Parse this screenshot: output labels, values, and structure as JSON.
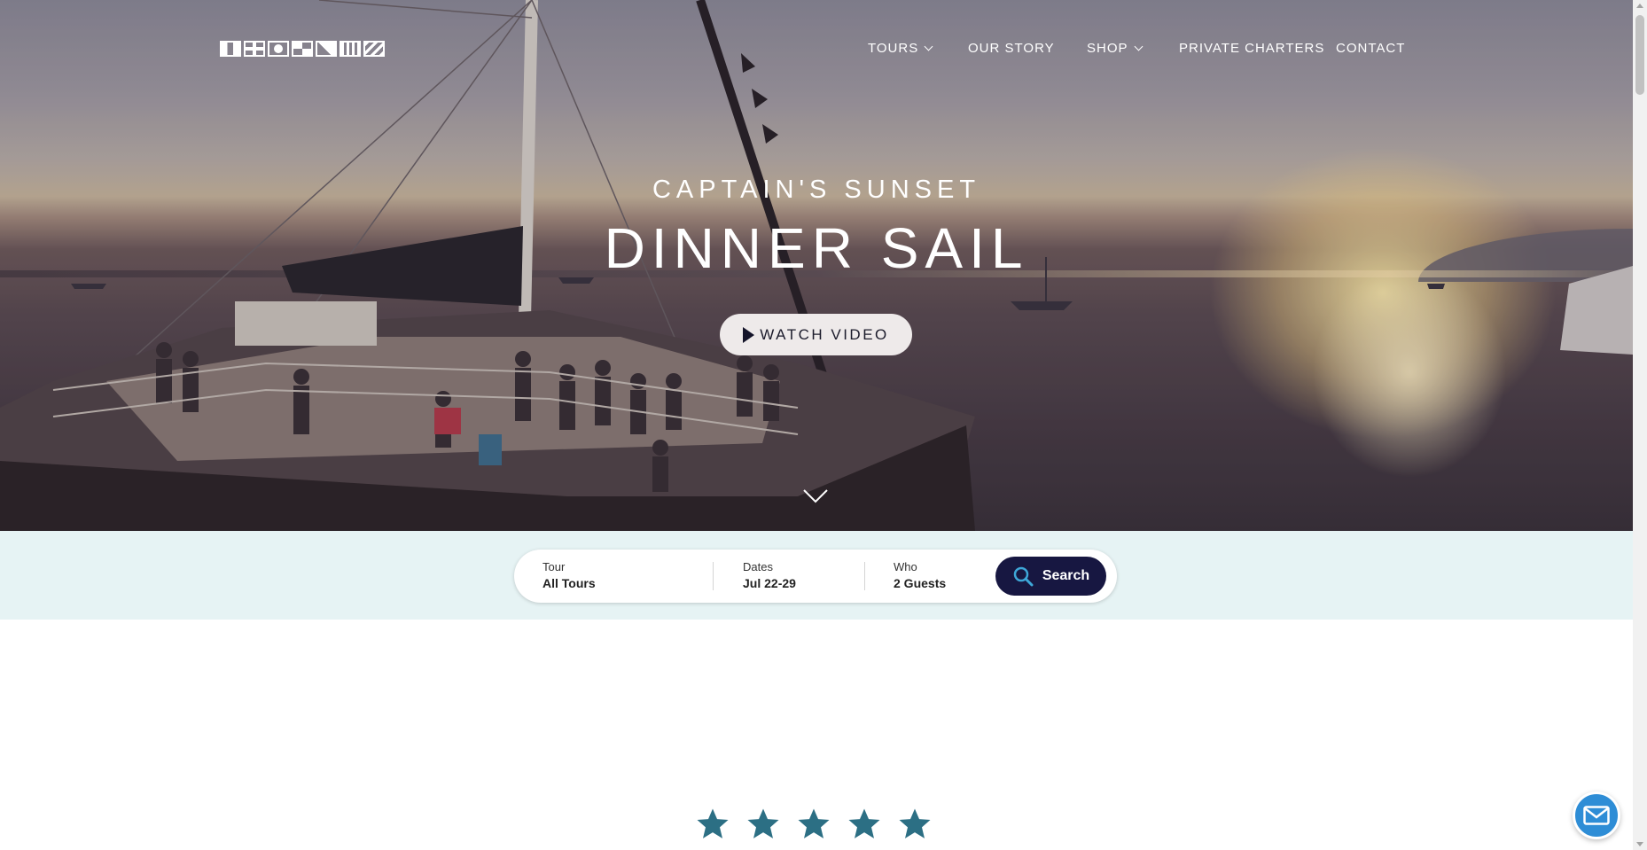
{
  "logo": {
    "name": "signal-flags-logo"
  },
  "nav": {
    "items": [
      {
        "label": "TOURS",
        "has_dropdown": true
      },
      {
        "label": "OUR STORY",
        "has_dropdown": false
      },
      {
        "label": "SHOP",
        "has_dropdown": true
      },
      {
        "label": "PRIVATE CHARTERS",
        "has_dropdown": false
      },
      {
        "label": "CONTACT",
        "has_dropdown": false
      }
    ]
  },
  "hero": {
    "subtitle": "CAPTAIN'S SUNSET",
    "title": "DINNER SAIL",
    "watch_video_label": "WATCH VIDEO",
    "scroll_icon": "chevron-down-icon"
  },
  "search": {
    "tour_label": "Tour",
    "tour_value": "All Tours",
    "dates_label": "Dates",
    "dates_value": "Jul 22-29",
    "who_label": "Who",
    "who_value": "2 Guests",
    "button_label": "Search",
    "button_icon": "search-icon"
  },
  "rating": {
    "stars": 5,
    "max": 5,
    "color": "#2c6f84"
  },
  "colors": {
    "accent_dark": "#171741",
    "search_band": "#e6f3f4",
    "chat_button": "#2e8dd6"
  },
  "chat": {
    "icon": "mail-icon"
  }
}
